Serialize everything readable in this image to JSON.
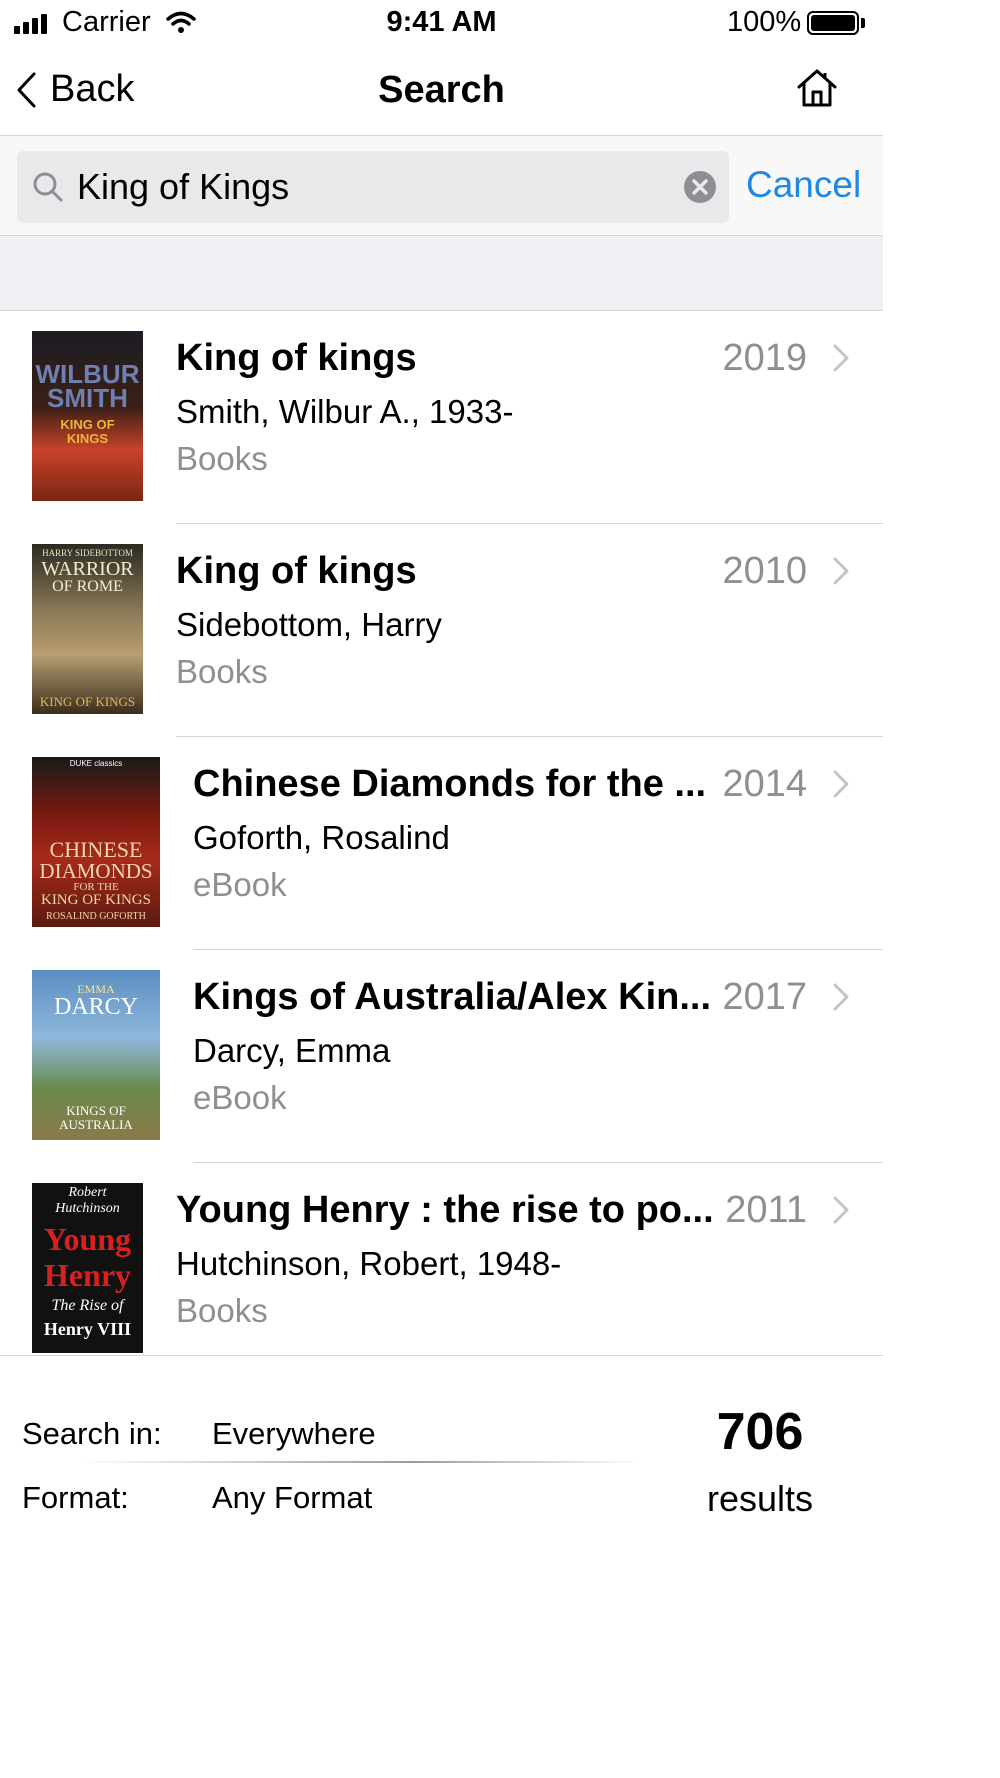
{
  "status_bar": {
    "carrier": "Carrier",
    "time": "9:41 AM",
    "battery": "100%"
  },
  "nav": {
    "back_label": "Back",
    "title": "Search"
  },
  "search": {
    "query": "King of Kings",
    "cancel_label": "Cancel"
  },
  "results": [
    {
      "title": "King of kings",
      "author": "Smith, Wilbur A., 1933-",
      "format": "Books",
      "year": "2019",
      "cover_lines": [
        "WILBUR",
        "SMITH",
        "KING OF",
        "KINGS"
      ]
    },
    {
      "title": "King of kings",
      "author": "Sidebottom, Harry",
      "format": "Books",
      "year": "2010",
      "cover_lines": [
        "HARRY SIDEBOTTOM",
        "WARRIOR",
        "OF ROME",
        "KING OF KINGS"
      ]
    },
    {
      "title": "Chinese Diamonds for the ...",
      "author": "Goforth, Rosalind",
      "format": "eBook",
      "year": "2014",
      "cover_lines": [
        "DUKE classics",
        "CHINESE",
        "DIAMONDS",
        "FOR THE",
        "KING OF KINGS",
        "ROSALIND GOFORTH"
      ]
    },
    {
      "title": "Kings of Australia/Alex Kin...",
      "author": "Darcy, Emma",
      "format": "eBook",
      "year": "2017",
      "cover_lines": [
        "EMMA",
        "DARCY",
        "KINGS OF",
        "AUSTRALIA"
      ]
    },
    {
      "title": "Young Henry : the rise to po...",
      "author": "Hutchinson, Robert, 1948-",
      "format": "Books",
      "year": "2011",
      "cover_lines": [
        "Robert",
        "Hutchinson",
        "Young",
        "Henry",
        "The Rise of",
        "Henry VIII"
      ]
    }
  ],
  "filters": {
    "search_in_label": "Search in:",
    "search_in_value": "Everywhere",
    "format_label": "Format:",
    "format_value": "Any Format"
  },
  "summary": {
    "count": "706",
    "label": "results"
  },
  "colors": {
    "accent": "#1e88e5",
    "secondary_text": "#8e8e93",
    "separator": "#d6d6da",
    "header_bg": "#efeff4"
  }
}
